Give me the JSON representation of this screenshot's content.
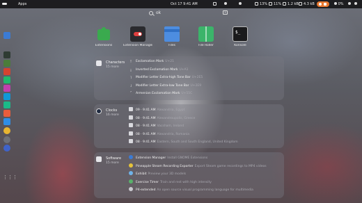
{
  "topbar": {
    "apps_label": "Apps",
    "clock": "Oct 17  9:41 AM",
    "battery_level": "13%",
    "volume_level": "11%",
    "upload": "1.2 kB",
    "download": "4.3 kB",
    "brightness_level": "0%"
  },
  "search": {
    "query": "ok"
  },
  "dock": [
    {
      "name": "files",
      "color": "#3b7bd4"
    },
    {
      "name": "terminal",
      "color": "#2f3b33"
    },
    {
      "name": "editor",
      "color": "#4b7d3a"
    },
    {
      "name": "browser",
      "color": "#d6432f"
    },
    {
      "name": "pycharm",
      "color": "#1fba6c"
    },
    {
      "name": "ide",
      "color": "#c23fae"
    },
    {
      "name": "webstorm",
      "color": "#0f98d8"
    },
    {
      "name": "clion",
      "color": "#1bba88"
    },
    {
      "name": "git",
      "color": "#e95d3c"
    },
    {
      "name": "store",
      "color": "#2f8ee6"
    },
    {
      "name": "chrome",
      "color": "#e7b531"
    },
    {
      "name": "settings",
      "color": "#6e7178"
    },
    {
      "name": "steam",
      "color": "#3f63c9"
    }
  ],
  "apps": [
    {
      "label": "Extensions",
      "color": "#3aaa4e"
    },
    {
      "label": "Extension Manager",
      "color": "#2a2a2e"
    },
    {
      "label": "Files",
      "color": "#4d8de0"
    },
    {
      "label": "File Roller",
      "color": "#3bb46a"
    },
    {
      "label": "Konsole",
      "color": "#1a1a1c"
    }
  ],
  "sections": [
    {
      "title": "Characters",
      "more": "15 more",
      "icon_color": "#e6e6ea",
      "rows": [
        {
          "glyph": "!",
          "name": "Exclamation Mark",
          "detail": "U+21"
        },
        {
          "glyph": "¡",
          "name": "Inverted Exclamation Mark",
          "detail": "U+A1"
        },
        {
          "glyph": "˥",
          "name": "Modifier Letter Extra-high Tone Bar",
          "detail": "U+2E5"
        },
        {
          "glyph": "˩",
          "name": "Modifier Letter Extra-low Tone Bar",
          "detail": "U+2E9"
        },
        {
          "glyph": "՜",
          "name": "Armenian Exclamation Mark",
          "detail": "U+55C"
        }
      ]
    },
    {
      "title": "Clocks",
      "more": "16 more",
      "icon_color": "#1f2a40",
      "rows": [
        {
          "glyph": "",
          "name": "09 · 9:41 AM",
          "detail": "Alexandria, Egypt"
        },
        {
          "glyph": "",
          "name": "08 · 9:41 AM",
          "detail": "Alexandroupolis, Greece"
        },
        {
          "glyph": "",
          "name": "08 · 9:41 AM",
          "detail": "Vacsham, Ireland"
        },
        {
          "glyph": "",
          "name": "08 · 9:41 AM",
          "detail": "Alexandria, Romania"
        },
        {
          "glyph": "",
          "name": "08 · 9:41 AM",
          "detail": "Eastern, South and South England, United Kingdom"
        }
      ]
    },
    {
      "title": "Software",
      "more": "15 more",
      "icon_color": "#e6e6ea",
      "rows": [
        {
          "glyph": "",
          "name": "Extension Manager",
          "detail": "Install GNOME Extensions"
        },
        {
          "glyph": "",
          "name": "Pineapple Steam Recording Exporter",
          "detail": "Export Steam game recordings to MP4 videos"
        },
        {
          "glyph": "",
          "name": "Exhibit",
          "detail": "Preview your 3D models"
        },
        {
          "glyph": "",
          "name": "Exercise Timer",
          "detail": "Train and rest with high intensity"
        },
        {
          "glyph": "",
          "name": "P4-extended",
          "detail": "An open source visual programming language for multimedia"
        }
      ]
    }
  ]
}
